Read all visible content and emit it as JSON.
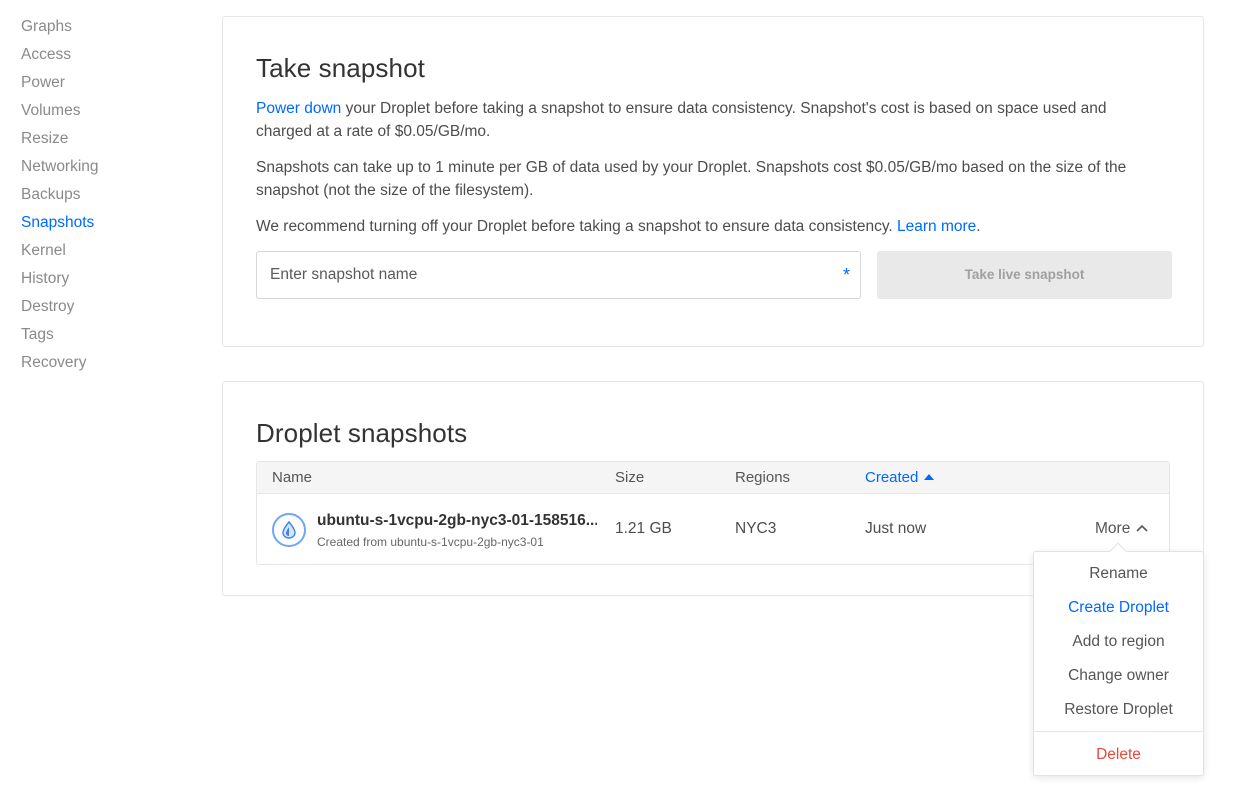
{
  "sidebar": {
    "items": [
      {
        "label": "Graphs"
      },
      {
        "label": "Access"
      },
      {
        "label": "Power"
      },
      {
        "label": "Volumes"
      },
      {
        "label": "Resize"
      },
      {
        "label": "Networking"
      },
      {
        "label": "Backups"
      },
      {
        "label": "Snapshots",
        "active": true
      },
      {
        "label": "Kernel"
      },
      {
        "label": "History"
      },
      {
        "label": "Destroy"
      },
      {
        "label": "Tags"
      },
      {
        "label": "Recovery"
      }
    ]
  },
  "take_snapshot": {
    "title": "Take snapshot",
    "p1_link": "Power down",
    "p1_text": " your Droplet before taking a snapshot to ensure data consistency. Snapshot's cost is based on space used and charged at a rate of $0.05/GB/mo.",
    "p2_text": "Snapshots can take up to 1 minute per GB of data used by your Droplet. Snapshots cost $0.05/GB/mo based on the size of the snapshot (not the size of the filesystem).",
    "p3_text": "We recommend turning off your Droplet before taking a snapshot to ensure data consistency. ",
    "p3_link": "Learn more",
    "p3_end": ".",
    "input_placeholder": "Enter snapshot name",
    "required_mark": "*",
    "button_label": "Take live snapshot"
  },
  "droplet_snapshots": {
    "title": "Droplet snapshots",
    "columns": {
      "name": "Name",
      "size": "Size",
      "regions": "Regions",
      "created": "Created"
    },
    "rows": [
      {
        "name": "ubuntu-s-1vcpu-2gb-nyc3-01-158516...",
        "subtitle": "Created from ubuntu-s-1vcpu-2gb-nyc3-01",
        "size": "1.21 GB",
        "region": "NYC3",
        "created": "Just now",
        "more_label": "More"
      }
    ]
  },
  "more_menu": {
    "items": [
      {
        "label": "Rename",
        "style": "normal"
      },
      {
        "label": "Create Droplet",
        "style": "blue"
      },
      {
        "label": "Add to region",
        "style": "normal"
      },
      {
        "label": "Change owner",
        "style": "normal"
      },
      {
        "label": "Restore Droplet",
        "style": "normal"
      },
      {
        "label": "Delete",
        "style": "red"
      }
    ]
  },
  "colors": {
    "accent": "#0069ff",
    "danger": "#e8493c",
    "muted": "#8a8a8a"
  }
}
